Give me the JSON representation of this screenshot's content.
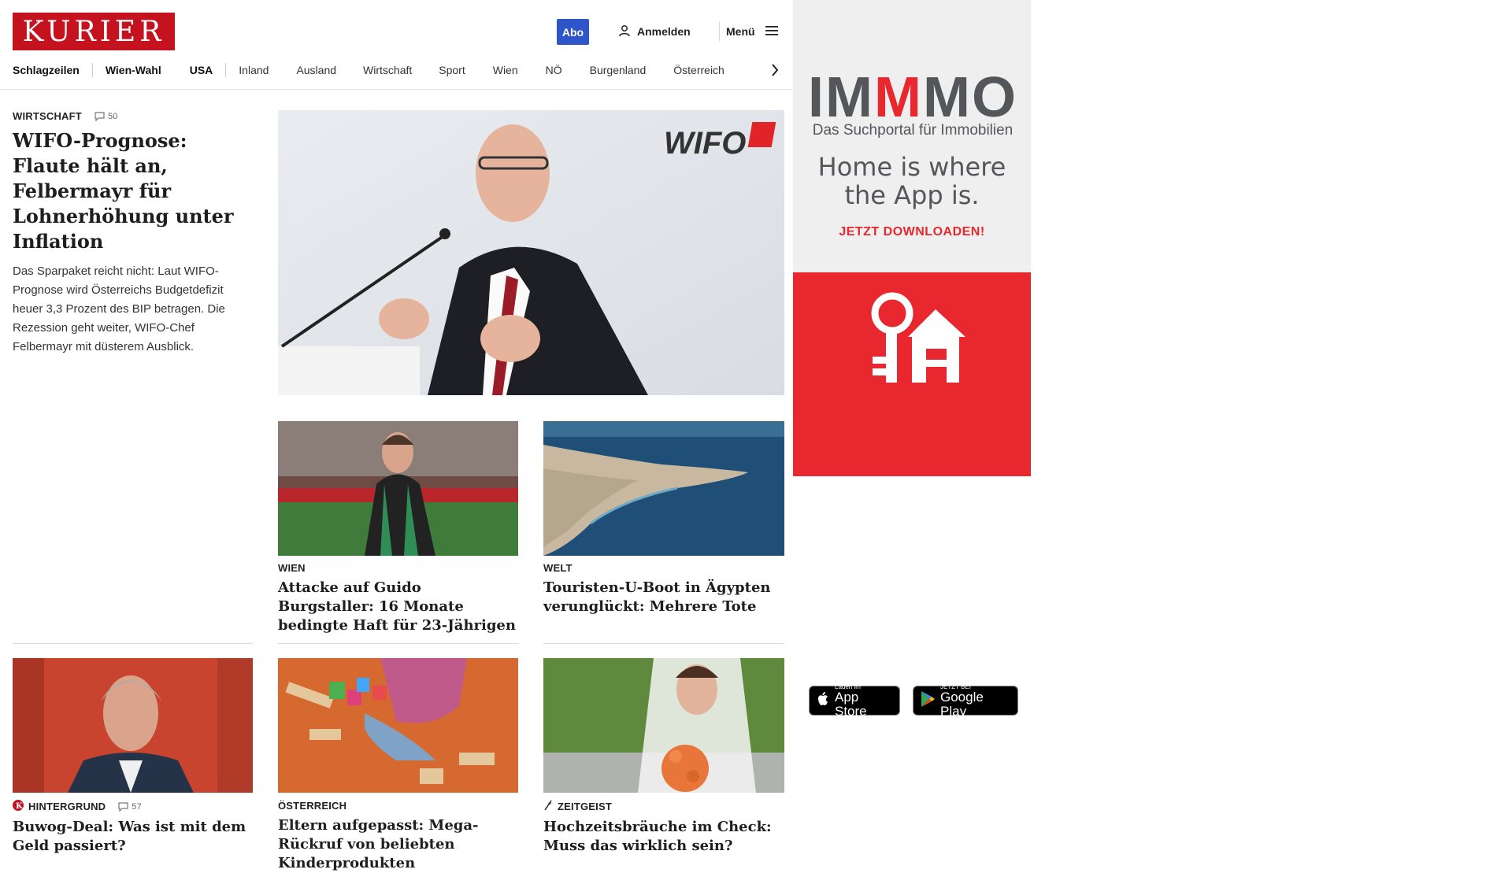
{
  "header": {
    "logo": "KURIER",
    "abo_label": "Abo",
    "login_label": "Anmelden",
    "menu_label": "Menü"
  },
  "nav": {
    "items": [
      "Schlagzeilen",
      "Wien-Wahl",
      "USA",
      "Inland",
      "Ausland",
      "Wirtschaft",
      "Sport",
      "Wien",
      "NÖ",
      "Burgenland",
      "Österreich"
    ]
  },
  "lead": {
    "kicker": "WIRTSCHAFT",
    "comments": "50",
    "headline": "WIFO-Prognose: Flaute hält an, Felbermayr für Lohnerhöhung unter Inflation",
    "teaser": "Das Sparpaket reicht nicht: Laut WIFO-Prognose wird Österreichs Budgetdefizit heuer 3,3 Prozent des BIP betragen. Die Rezession geht weiter, WIFO-Chef Felbermayr mit düsterem Ausblick.",
    "image_text": "WIFO"
  },
  "articles": [
    {
      "kicker": "WIEN",
      "headline": "Attacke auf Guido Burgstaller: 16 Monate bedingte Haft für 23-Jährigen"
    },
    {
      "kicker": "WELT",
      "headline": "Touristen-U-Boot in Ägypten verunglückt: Mehrere Tote"
    },
    {
      "kicker": "HINTERGRUND",
      "comments": "57",
      "headline": "Buwog-Deal: Was ist mit dem Geld passiert?"
    },
    {
      "kicker": "ÖSTERREICH",
      "headline": "Eltern aufgepasst: Mega-Rückruf von beliebten Kinderprodukten"
    },
    {
      "kicker": "ZEITGEIST",
      "headline": "Hochzeitsbräuche im Check: Muss das wirklich sein?"
    }
  ],
  "ad": {
    "brand_parts": [
      "IM",
      "M",
      "MO"
    ],
    "subtitle": "Das Suchportal für Immobilien",
    "slogan": "Home is where the App is.",
    "cta": "JETZT DOWNLOADEN!",
    "appstore_small": "Laden im",
    "appstore_big": "App Store",
    "googleplay_small": "JETZT BEI",
    "googleplay_big": "Google Play"
  },
  "colors": {
    "brand_red": "#c4121f",
    "abo_blue": "#2f56c9",
    "ad_red": "#e8272e",
    "ad_grey": "#55565a"
  }
}
